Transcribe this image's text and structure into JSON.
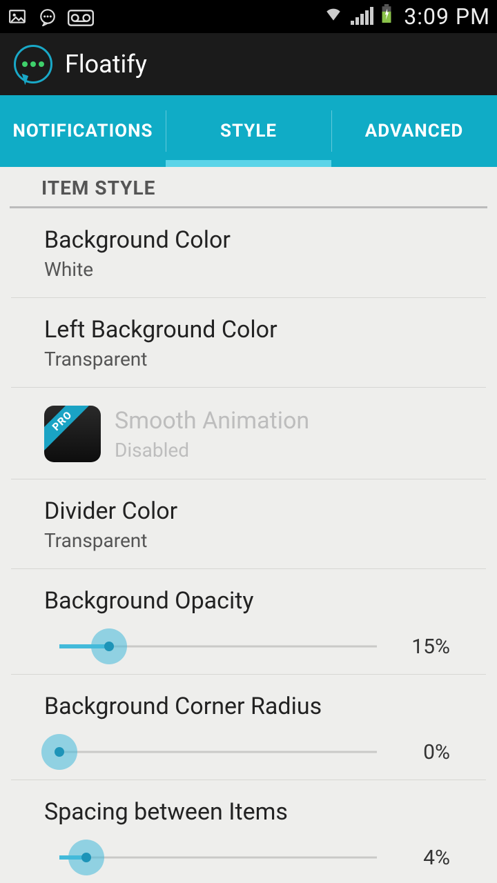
{
  "status": {
    "time": "3:09 PM"
  },
  "app": {
    "title": "Floatify"
  },
  "tabs": {
    "notifications": "NOTIFICATIONS",
    "style": "STYLE",
    "advanced": "ADVANCED",
    "active": "style"
  },
  "section": {
    "item_style": "ITEM STYLE"
  },
  "settings": {
    "bg_color": {
      "title": "Background Color",
      "value": "White"
    },
    "left_bg_color": {
      "title": "Left Background Color",
      "value": "Transparent"
    },
    "smooth_anim": {
      "title": "Smooth Animation",
      "value": "Disabled",
      "pro_badge": "PRO"
    },
    "divider_color": {
      "title": "Divider Color",
      "value": "Transparent"
    },
    "bg_opacity": {
      "title": "Background Opacity",
      "percent": 15,
      "display": "15%"
    },
    "corner_radius": {
      "title": "Background Corner Radius",
      "percent": 0,
      "display": "0%"
    },
    "spacing": {
      "title": "Spacing between Items",
      "percent": 4,
      "display": "4%"
    }
  }
}
